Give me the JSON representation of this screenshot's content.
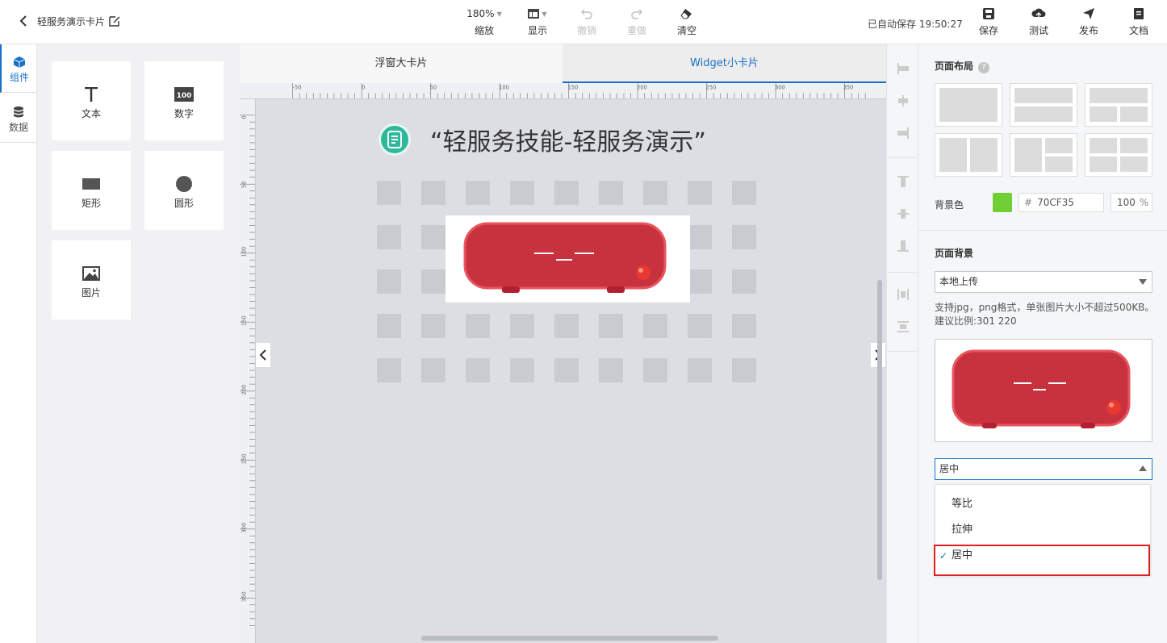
{
  "header": {
    "back_icon": "chevron-left-icon",
    "title": "轻服务演示卡片",
    "edit_icon": "edit-icon",
    "zoom": "180%",
    "zoom_label": "缩放",
    "toolbar": [
      {
        "label": "显示",
        "icon": "layout-icon",
        "enabled": true
      },
      {
        "label": "撤销",
        "icon": "undo-icon",
        "enabled": false
      },
      {
        "label": "重做",
        "icon": "redo-icon",
        "enabled": false
      },
      {
        "label": "清空",
        "icon": "eraser-icon",
        "enabled": true
      }
    ],
    "autosave": "已自动保存 19:50:27",
    "actions": [
      {
        "label": "保存",
        "icon": "save-icon"
      },
      {
        "label": "测试",
        "icon": "cloud-upload-icon"
      },
      {
        "label": "发布",
        "icon": "send-icon"
      },
      {
        "label": "文档",
        "icon": "document-icon"
      }
    ]
  },
  "rail": {
    "tabs": [
      {
        "label": "组件",
        "icon": "cube-icon",
        "active": true
      },
      {
        "label": "数据",
        "icon": "database-icon",
        "active": false
      }
    ]
  },
  "components": [
    {
      "label": "文本",
      "icon": "text-icon"
    },
    {
      "label": "数字",
      "icon": "number-icon"
    },
    {
      "label": "矩形",
      "icon": "rectangle-icon"
    },
    {
      "label": "圆形",
      "icon": "circle-icon"
    },
    {
      "label": "图片",
      "icon": "image-icon"
    }
  ],
  "canvas": {
    "tabs": [
      {
        "label": "浮窗大卡片",
        "active": false
      },
      {
        "label": "Widget小卡片",
        "active": true
      }
    ],
    "ruler_h": [
      "-50",
      "0",
      "50",
      "100",
      "150",
      "200",
      "250",
      "300",
      "350"
    ],
    "ruler_v": [
      "0",
      "50",
      "100",
      "150",
      "200",
      "250",
      "300",
      "350"
    ],
    "card_title": "“轻服务技能-轻服务演示”",
    "card_logo_icon": "service-logo-icon",
    "card_image_icon": "red-device-image"
  },
  "right_panel": {
    "layout_title": "页面布局",
    "help_icon": "question-icon",
    "bg_color_label": "背景色",
    "bg_color_hash": "#",
    "bg_color_value": "70CF35",
    "bg_color_hex": "#70CF35",
    "bg_opacity": "100",
    "bg_opacity_unit": "%",
    "bg_title": "页面背景",
    "upload_select": "本地上传",
    "hint": "支持jpg，png格式，单张图片大小不超过500KB。建议比例:301 220",
    "fit_select": "居中",
    "fit_options": [
      {
        "label": "等比",
        "selected": false
      },
      {
        "label": "拉伸",
        "selected": false
      },
      {
        "label": "居中",
        "selected": true
      }
    ]
  },
  "colors": {
    "accent": "#1a70c8",
    "highlight": "#e02020",
    "device_red": "#c8323e"
  }
}
